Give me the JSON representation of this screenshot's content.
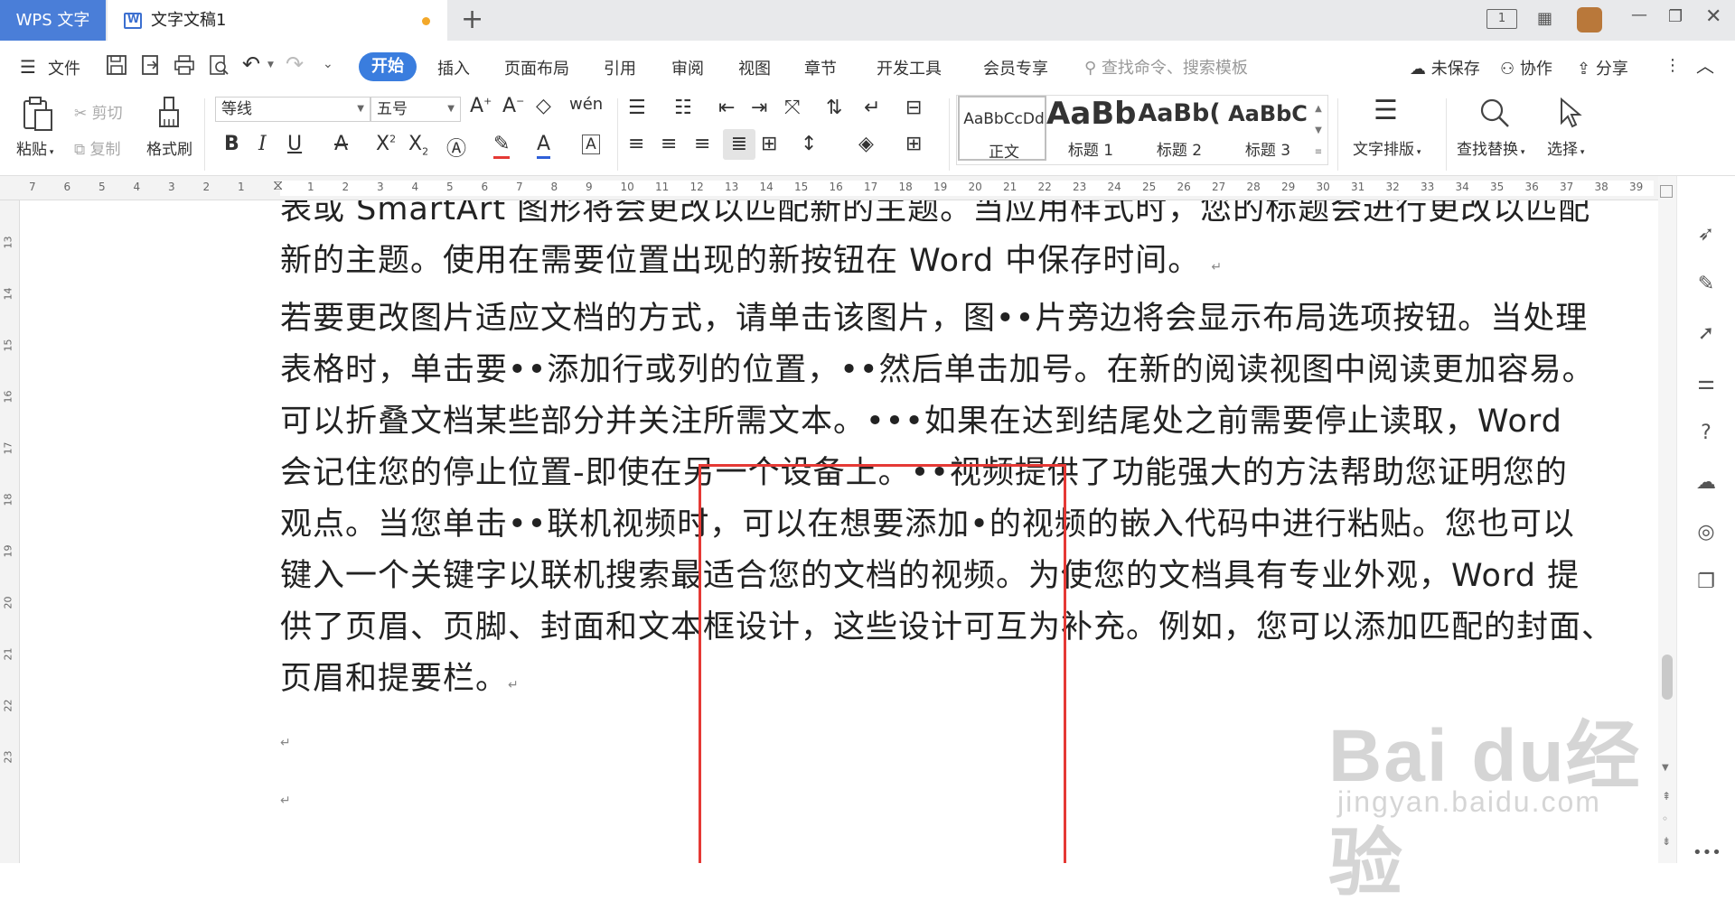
{
  "titlebar": {
    "app_tab": "WPS 文字",
    "doc_tab": "文字文稿1",
    "new_tab": "+",
    "page_indicator": "1"
  },
  "menubar": {
    "file": "文件",
    "tabs": [
      "开始",
      "插入",
      "页面布局",
      "引用",
      "审阅",
      "视图",
      "章节",
      "开发工具",
      "会员专享"
    ],
    "search_placeholder": "查找命令、搜索模板",
    "unsaved": "未保存",
    "collaborate": "协作",
    "share": "分享"
  },
  "ribbon": {
    "paste": "粘贴",
    "cut": "剪切",
    "copy": "复制",
    "format_painter": "格式刷",
    "font_name": "等线",
    "font_size": "五号",
    "styles": [
      {
        "sample": "AaBbCcDd",
        "name": "正文"
      },
      {
        "sample": "AaBb",
        "name": "标题 1"
      },
      {
        "sample": "AaBb(",
        "name": "标题 2"
      },
      {
        "sample": "AaBbC",
        "name": "标题 3"
      }
    ],
    "text_layout": "文字排版",
    "find_replace": "查找替换",
    "select": "选择"
  },
  "ruler": {
    "ticks": [
      "7",
      "6",
      "5",
      "4",
      "3",
      "2",
      "1",
      "",
      "1",
      "2",
      "3",
      "4",
      "5",
      "6",
      "7",
      "8",
      "9",
      "10",
      "11",
      "12",
      "13",
      "14",
      "15",
      "16",
      "17",
      "18",
      "19",
      "20",
      "21",
      "22",
      "23",
      "24",
      "25",
      "26",
      "27",
      "28",
      "29",
      "30",
      "31",
      "32",
      "33",
      "34",
      "35",
      "36",
      "37",
      "38",
      "39"
    ],
    "vticks": [
      "13",
      "14",
      "15",
      "16",
      "17",
      "18",
      "19",
      "20",
      "21",
      "22",
      "23"
    ]
  },
  "document": {
    "lines": [
      "表或 SmartArt 图形将会更改以匹配新的主题。当应用样式时，您的标题会进行更改以匹配",
      "新的主题。使用在需要位置出现的新按钮在 Word 中保存时间。",
      "若要更改图片适应文档的方式，请单击该图片，图••片旁边将会显示布局选项按钮。当处理",
      "表格时，单击要••添加行或列的位置，••然后单击加号。在新的阅读视图中阅读更加容易。",
      "可以折叠文档某些部分并关注所需文本。•••如果在达到结尾处之前需要停止读取，Word",
      "会记住您的停止位置-即使在另一个设备上。••视频提供了功能强大的方法帮助您证明您的",
      "观点。当您单击••联机视频时，可以在想要添加•的视频的嵌入代码中进行粘贴。您也可以",
      "键入一个关键字以联机搜索最适合您的文档的视频。为使您的文档具有专业外观，Word 提",
      "供了页眉、页脚、封面和文本框设计，这些设计可互为补充。例如，您可以添加匹配的封面、",
      "页眉和提要栏。"
    ],
    "para_mark": "↵"
  },
  "watermark": {
    "brand": "Bai du经验",
    "url": "jingyan.baidu.com"
  },
  "colors": {
    "accent": "#3a7dde",
    "wps_tab": "#4a7ed8",
    "highlight_box": "#e53935",
    "modified_dot": "#f3a829"
  }
}
